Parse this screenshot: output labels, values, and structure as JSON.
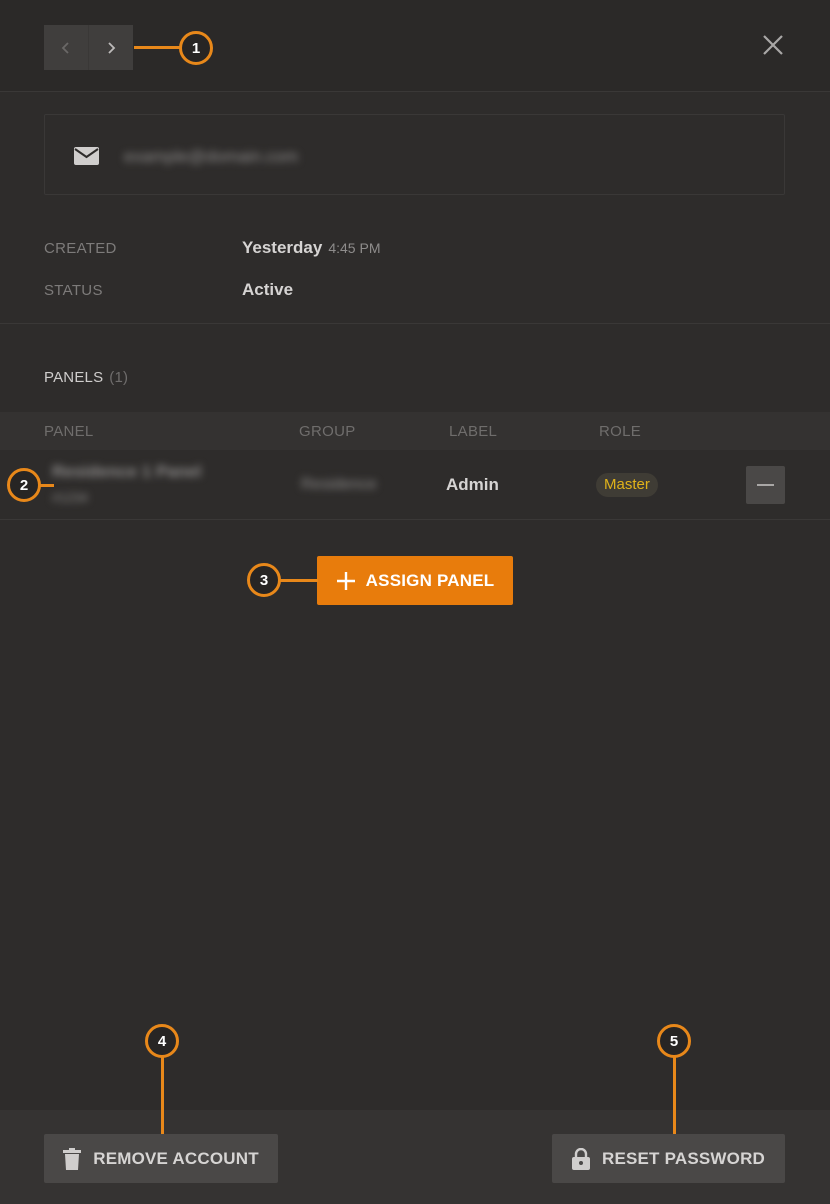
{
  "topbar": {
    "prev_icon": "chevron-left-icon",
    "next_icon": "chevron-right-icon",
    "close_icon": "close-icon"
  },
  "account": {
    "email_icon": "mail-icon",
    "email": "example@domain.com",
    "created_label": "CREATED",
    "created_day": "Yesterday",
    "created_time": "4:45 PM",
    "status_label": "STATUS",
    "status_value": "Active"
  },
  "panels": {
    "title": "PANELS",
    "count": "(1)",
    "columns": [
      "PANEL",
      "GROUP",
      "LABEL",
      "ROLE"
    ],
    "rows": [
      {
        "panel_name": "Residence 1 Panel",
        "panel_sub": "#1234",
        "group": "Residence",
        "label": "Admin",
        "role": "Master"
      }
    ],
    "assign_label": "ASSIGN PANEL"
  },
  "footer": {
    "remove_label": "REMOVE ACCOUNT",
    "reset_label": "RESET PASSWORD"
  },
  "callouts": [
    "1",
    "2",
    "3",
    "4",
    "5"
  ],
  "colors": {
    "accent": "#e87c0c",
    "role_badge": "#e0b21a",
    "background": "#2e2c2b"
  }
}
